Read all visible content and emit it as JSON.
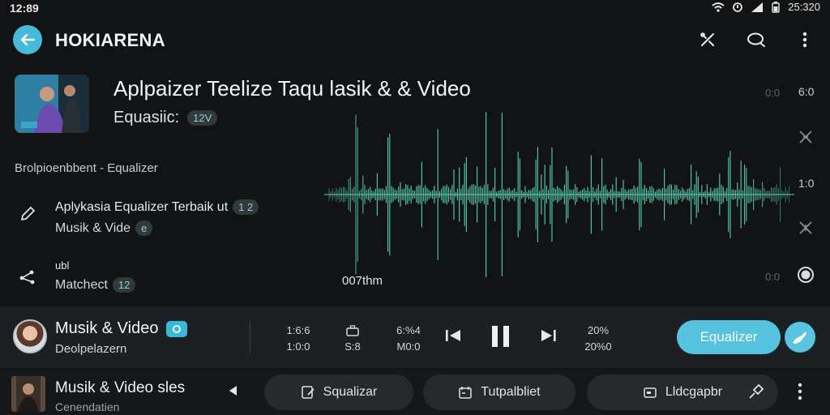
{
  "status_bar": {
    "time": "12:89",
    "right_time": "25:320"
  },
  "app_bar": {
    "title": "HOKIARENA"
  },
  "header": {
    "track_title": "Aplpaizer Teelize Taqu lasik & & Video",
    "subtitle": "Equasiic:",
    "badge": "12V"
  },
  "section_label": "Brolpioenbbent - Equalizer",
  "list_items": [
    {
      "line1": "Aplykasia Equalizer Terbaik ut",
      "badge1": "1 2",
      "line2": "Musik & Vide",
      "badge2": "e",
      "icon": "pencil-icon"
    },
    {
      "line1": "ubl",
      "badge1": "",
      "line2": "Matchect",
      "badge2": "12",
      "icon": "share-nodes-icon"
    }
  ],
  "waveform": {
    "time": "007thm",
    "scale_right": [
      "6:0",
      "1:0",
      "0:0"
    ],
    "scale_dim": [
      "0:0",
      "0:0"
    ],
    "color": "#59d3b6"
  },
  "player": {
    "title": "Musik & Video",
    "subtitle": "Deolpelazern",
    "stats": [
      {
        "top": "1:6:6",
        "bottom": "1:0:0"
      },
      {
        "top": "",
        "bottom": "S:8"
      },
      {
        "top": "6:%4",
        "bottom": "M0:0"
      },
      {
        "top": "20%",
        "bottom": "20%0"
      }
    ],
    "eq_button": "Equalizer",
    "accent": "#57c2dd"
  },
  "bottom_bar": {
    "title": "Musik & Video sles",
    "subtitle": "Cenendatien",
    "chips": [
      {
        "label": "Squalizar",
        "icon": "edit-note-icon"
      },
      {
        "label": "Tutpalbliet",
        "icon": "calendar-icon"
      },
      {
        "label": "Lldcgapbr",
        "icon": "tag-icon"
      }
    ]
  }
}
